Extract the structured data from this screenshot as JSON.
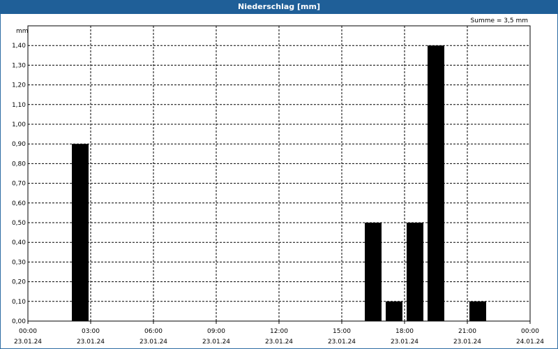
{
  "title": "Niederschlag [mm]",
  "summary": "Summe = 3,5 mm",
  "colors": {
    "titlebar": "#1f5f98",
    "bars": "#000000",
    "grid": "#000000"
  },
  "chart_data": {
    "type": "bar",
    "title": "Niederschlag [mm]",
    "ylabel": "mm",
    "xlabel": "",
    "ylim": [
      0,
      1.5
    ],
    "yticks": [
      "0,00",
      "0,10",
      "0,20",
      "0,30",
      "0,40",
      "0,50",
      "0,60",
      "0,70",
      "0,80",
      "0,90",
      "1,00",
      "1,10",
      "1,20",
      "1,30",
      "1,40"
    ],
    "xticks": [
      {
        "time": "00:00",
        "date": "23.01.24"
      },
      {
        "time": "03:00",
        "date": "23.01.24"
      },
      {
        "time": "06:00",
        "date": "23.01.24"
      },
      {
        "time": "09:00",
        "date": "23.01.24"
      },
      {
        "time": "12:00",
        "date": "23.01.24"
      },
      {
        "time": "15:00",
        "date": "23.01.24"
      },
      {
        "time": "18:00",
        "date": "23.01.24"
      },
      {
        "time": "21:00",
        "date": "23.01.24"
      },
      {
        "time": "00:00",
        "date": "24.01.24"
      }
    ],
    "xlim_hours": [
      0,
      24
    ],
    "grid": true,
    "bars": [
      {
        "hour_end": 3,
        "value": 0.9
      },
      {
        "hour_end": 17,
        "value": 0.5
      },
      {
        "hour_end": 18,
        "value": 0.1
      },
      {
        "hour_end": 19,
        "value": 0.5
      },
      {
        "hour_end": 20,
        "value": 1.4
      },
      {
        "hour_end": 22,
        "value": 0.1
      }
    ]
  }
}
